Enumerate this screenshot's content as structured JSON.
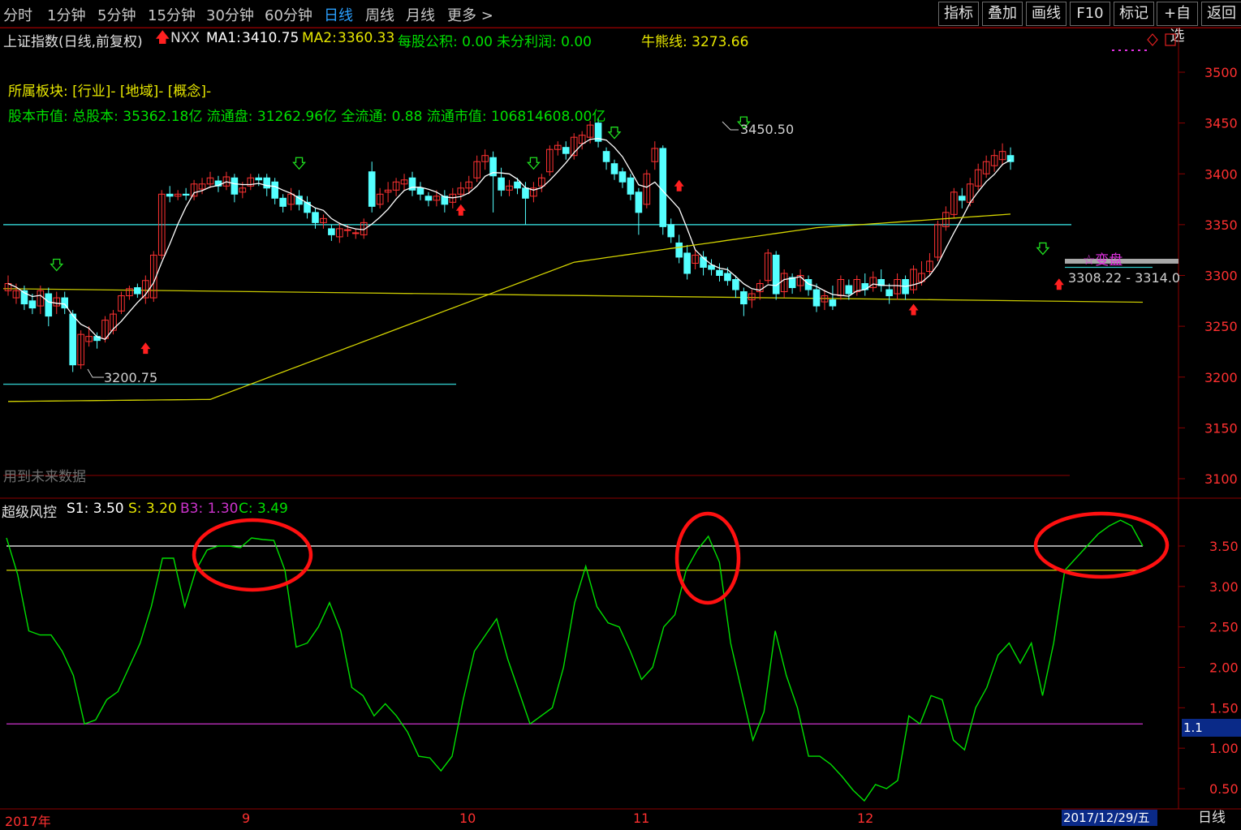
{
  "toolbar": {
    "periods": [
      "分时",
      "1分钟",
      "5分钟",
      "15分钟",
      "30分钟",
      "60分钟",
      "日线",
      "周线",
      "月线",
      "更多 >"
    ],
    "active_period": "日线",
    "buttons": [
      "指标",
      "叠加",
      "画线",
      "F10",
      "标记",
      "+自选",
      "返回"
    ]
  },
  "header": {
    "title": "上证指数(日线,前复权)",
    "nxx": "NXX",
    "ma1_label": "MA1:",
    "ma1_value": "3410.75",
    "ma2_label": "MA2:",
    "ma2_value": "3360.33",
    "gongji": "每股公积: 0.00",
    "weifen": "未分利润: 0.00",
    "niuxiong": "牛熊线: 3273.66",
    "bankuai": "所属板块: [行业]- [地域]- [概念]-",
    "guben": "股本市值: 总股本: 35362.18亿 流通盘: 31262.96亿 全流通: 0.88 流通市值: 106814608.00亿",
    "future_note": "用到未来数据"
  },
  "annotations": {
    "low_label": "3200.75",
    "high_label": "3450.50",
    "change_label": "☆变盘",
    "range_label": "3308.22 - 3314.0"
  },
  "indicator": {
    "name": "超级风控",
    "s1": "S1: 3.50",
    "s": "S: 3.20",
    "b3": "B3: 1.30",
    "c": "C: 3.49",
    "current_label": "1.1"
  },
  "date_axis": {
    "labels": [
      "2017年",
      "9",
      "10",
      "11",
      "12"
    ],
    "current_date": "2017/12/29/五",
    "period_label": "日线"
  },
  "colors": {
    "up": "#ff3232",
    "down": "#54ffff",
    "ma1": "#ffffff",
    "ma2": "#d4d400",
    "indicator_line": "#00e000",
    "s1_line": "#ffffff",
    "s_line": "#d4d400",
    "b3_line": "#cc33cc",
    "grid": "#8b0000",
    "axis_text": "#ff3030",
    "highlight": "#ff1010"
  },
  "chart_data": [
    {
      "type": "candlestick",
      "ylim": [
        3080,
        3520
      ],
      "y_ticks": [
        3100,
        3150,
        3200,
        3250,
        3300,
        3350,
        3400,
        3450,
        3500
      ],
      "candles": [
        [
          3285,
          3292,
          3280,
          3300
        ],
        [
          3278,
          3285,
          3272,
          3292
        ],
        [
          3285,
          3272,
          3266,
          3290
        ],
        [
          3275,
          3268,
          3262,
          3282
        ],
        [
          3270,
          3285,
          3262,
          3290
        ],
        [
          3282,
          3260,
          3250,
          3288
        ],
        [
          3270,
          3278,
          3262,
          3284
        ],
        [
          3278,
          3268,
          3262,
          3284
        ],
        [
          3262,
          3212,
          3205,
          3266
        ],
        [
          3212,
          3242,
          3208,
          3246
        ],
        [
          3235,
          3240,
          3230,
          3250
        ],
        [
          3240,
          3236,
          3228,
          3244
        ],
        [
          3238,
          3256,
          3234,
          3260
        ],
        [
          3246,
          3262,
          3242,
          3266
        ],
        [
          3265,
          3280,
          3262,
          3284
        ],
        [
          3280,
          3287,
          3276,
          3290
        ],
        [
          3288,
          3282,
          3278,
          3292
        ],
        [
          3278,
          3295,
          3272,
          3300
        ],
        [
          3278,
          3320,
          3274,
          3324
        ],
        [
          3320,
          3380,
          3316,
          3384
        ],
        [
          3380,
          3378,
          3372,
          3388
        ],
        [
          3378,
          3380,
          3374,
          3384
        ],
        [
          3380,
          3379,
          3374,
          3386
        ],
        [
          3378,
          3390,
          3374,
          3394
        ],
        [
          3385,
          3390,
          3380,
          3396
        ],
        [
          3390,
          3396,
          3386,
          3402
        ],
        [
          3393,
          3388,
          3382,
          3398
        ],
        [
          3388,
          3397,
          3384,
          3402
        ],
        [
          3396,
          3380,
          3372,
          3400
        ],
        [
          3382,
          3386,
          3376,
          3392
        ],
        [
          3388,
          3396,
          3384,
          3400
        ],
        [
          3396,
          3394,
          3388,
          3400
        ],
        [
          3396,
          3386,
          3378,
          3400
        ],
        [
          3392,
          3376,
          3370,
          3396
        ],
        [
          3376,
          3368,
          3362,
          3380
        ],
        [
          3370,
          3380,
          3364,
          3386
        ],
        [
          3378,
          3370,
          3364,
          3384
        ],
        [
          3372,
          3362,
          3356,
          3378
        ],
        [
          3362,
          3352,
          3346,
          3366
        ],
        [
          3352,
          3356,
          3346,
          3360
        ],
        [
          3346,
          3340,
          3334,
          3350
        ],
        [
          3338,
          3346,
          3332,
          3352
        ],
        [
          3345,
          3345,
          3338,
          3350
        ],
        [
          3342,
          3342,
          3336,
          3346
        ],
        [
          3340,
          3352,
          3336,
          3356
        ],
        [
          3402,
          3368,
          3362,
          3412
        ],
        [
          3370,
          3380,
          3366,
          3386
        ],
        [
          3382,
          3384,
          3372,
          3392
        ],
        [
          3384,
          3392,
          3378,
          3396
        ],
        [
          3390,
          3394,
          3384,
          3400
        ],
        [
          3396,
          3384,
          3378,
          3402
        ],
        [
          3386,
          3380,
          3374,
          3392
        ],
        [
          3378,
          3374,
          3368,
          3382
        ],
        [
          3374,
          3378,
          3368,
          3384
        ],
        [
          3378,
          3370,
          3362,
          3384
        ],
        [
          3372,
          3380,
          3366,
          3386
        ],
        [
          3380,
          3386,
          3374,
          3392
        ],
        [
          3386,
          3392,
          3380,
          3398
        ],
        [
          3396,
          3412,
          3392,
          3418
        ],
        [
          3412,
          3418,
          3404,
          3424
        ],
        [
          3416,
          3398,
          3362,
          3422
        ],
        [
          3396,
          3384,
          3378,
          3406
        ],
        [
          3384,
          3388,
          3378,
          3394
        ],
        [
          3392,
          3386,
          3380,
          3396
        ],
        [
          3386,
          3376,
          3350,
          3392
        ],
        [
          3378,
          3386,
          3372,
          3392
        ],
        [
          3388,
          3396,
          3382,
          3400
        ],
        [
          3402,
          3424,
          3398,
          3428
        ],
        [
          3424,
          3428,
          3418,
          3432
        ],
        [
          3426,
          3420,
          3414,
          3432
        ],
        [
          3418,
          3436,
          3414,
          3440
        ],
        [
          3430,
          3438,
          3424,
          3442
        ],
        [
          3436,
          3448,
          3430,
          3452
        ],
        [
          3450,
          3432,
          3426,
          3455
        ],
        [
          3422,
          3412,
          3404,
          3426
        ],
        [
          3410,
          3400,
          3394,
          3414
        ],
        [
          3402,
          3392,
          3386,
          3406
        ],
        [
          3396,
          3380,
          3374,
          3400
        ],
        [
          3382,
          3362,
          3340,
          3386
        ],
        [
          3370,
          3400,
          3366,
          3404
        ],
        [
          3412,
          3425,
          3404,
          3432
        ],
        [
          3425,
          3348,
          3340,
          3428
        ],
        [
          3350,
          3338,
          3332,
          3356
        ],
        [
          3332,
          3318,
          3312,
          3340
        ],
        [
          3322,
          3302,
          3296,
          3330
        ],
        [
          3312,
          3320,
          3306,
          3326
        ],
        [
          3318,
          3308,
          3300,
          3324
        ],
        [
          3310,
          3306,
          3300,
          3316
        ],
        [
          3305,
          3300,
          3294,
          3312
        ],
        [
          3302,
          3295,
          3290,
          3308
        ],
        [
          3296,
          3286,
          3278,
          3300
        ],
        [
          3284,
          3272,
          3260,
          3288
        ],
        [
          3276,
          3282,
          3268,
          3286
        ],
        [
          3284,
          3292,
          3276,
          3296
        ],
        [
          3295,
          3322,
          3292,
          3326
        ],
        [
          3320,
          3282,
          3276,
          3324
        ],
        [
          3284,
          3302,
          3278,
          3306
        ],
        [
          3298,
          3288,
          3282,
          3302
        ],
        [
          3290,
          3300,
          3284,
          3306
        ],
        [
          3296,
          3286,
          3280,
          3300
        ],
        [
          3286,
          3270,
          3264,
          3292
        ],
        [
          3274,
          3280,
          3266,
          3286
        ],
        [
          3276,
          3270,
          3266,
          3290
        ],
        [
          3280,
          3296,
          3276,
          3300
        ],
        [
          3290,
          3282,
          3276,
          3296
        ],
        [
          3284,
          3296,
          3280,
          3300
        ],
        [
          3292,
          3286,
          3280,
          3302
        ],
        [
          3288,
          3298,
          3284,
          3304
        ],
        [
          3296,
          3290,
          3284,
          3306
        ],
        [
          3286,
          3280,
          3272,
          3292
        ],
        [
          3282,
          3296,
          3276,
          3302
        ],
        [
          3296,
          3282,
          3276,
          3300
        ],
        [
          3286,
          3306,
          3282,
          3310
        ],
        [
          3294,
          3302,
          3290,
          3314
        ],
        [
          3304,
          3314,
          3300,
          3322
        ],
        [
          3318,
          3350,
          3314,
          3354
        ],
        [
          3348,
          3362,
          3344,
          3368
        ],
        [
          3360,
          3382,
          3356,
          3386
        ],
        [
          3378,
          3374,
          3366,
          3386
        ],
        [
          3372,
          3390,
          3368,
          3396
        ],
        [
          3388,
          3404,
          3384,
          3410
        ],
        [
          3400,
          3412,
          3396,
          3418
        ],
        [
          3408,
          3418,
          3402,
          3424
        ],
        [
          3414,
          3422,
          3408,
          3430
        ],
        [
          3418,
          3412,
          3404,
          3426
        ]
      ],
      "ma1_tail": 3410.75,
      "ma2_tail": 3360.33,
      "horizontal_levels": [
        3350,
        3200,
        3273.66
      ]
    },
    {
      "type": "line",
      "ylim": [
        0.3,
        4.0
      ],
      "y_ticks": [
        0.5,
        1.0,
        1.5,
        2.0,
        2.5,
        3.0,
        3.5
      ],
      "series": [
        {
          "name": "S1",
          "values": [
            3.5
          ]
        },
        {
          "name": "S",
          "values": [
            3.2
          ]
        },
        {
          "name": "B3",
          "values": [
            1.3
          ]
        },
        {
          "name": "C",
          "values": [
            3.6,
            3.15,
            2.45,
            2.4,
            2.4,
            2.2,
            1.9,
            1.3,
            1.35,
            1.6,
            1.7,
            2.0,
            2.3,
            2.75,
            3.35,
            3.35,
            2.75,
            3.2,
            3.45,
            3.5,
            3.5,
            3.48,
            3.6,
            3.58,
            3.57,
            3.2,
            2.25,
            2.3,
            2.5,
            2.8,
            2.45,
            1.75,
            1.65,
            1.4,
            1.55,
            1.4,
            1.2,
            0.9,
            0.88,
            0.72,
            0.9,
            1.6,
            2.2,
            2.4,
            2.6,
            2.1,
            1.7,
            1.3,
            1.4,
            1.5,
            2.0,
            2.8,
            3.25,
            2.75,
            2.55,
            2.5,
            2.2,
            1.85,
            2.0,
            2.5,
            2.65,
            3.2,
            3.45,
            3.62,
            3.3,
            2.3,
            1.7,
            1.1,
            1.45,
            2.45,
            1.9,
            1.5,
            0.9,
            0.9,
            0.8,
            0.65,
            0.48,
            0.35,
            0.55,
            0.5,
            0.6,
            1.4,
            1.3,
            1.65,
            1.6,
            1.1,
            0.98,
            1.5,
            1.75,
            2.15,
            2.3,
            2.05,
            2.3,
            1.65,
            2.3,
            3.2,
            3.35,
            3.5,
            3.65,
            3.75,
            3.82,
            3.75,
            3.5
          ]
        }
      ]
    }
  ]
}
